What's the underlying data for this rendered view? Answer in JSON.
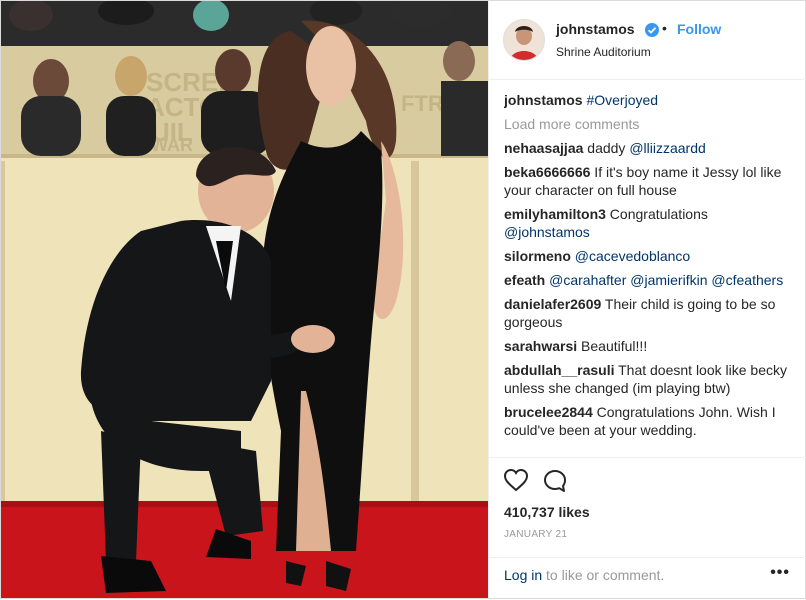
{
  "post": {
    "username": "johnstamos",
    "dot": "•",
    "follow_label": "Follow",
    "location": "Shrine Auditorium",
    "caption_user": "johnstamos",
    "caption_tag": "#Overjoyed",
    "load_more": "Load more comments",
    "likes": "410,737 likes",
    "date": "JANUARY 21",
    "login_link": "Log in",
    "login_rest": " to like or comment.",
    "more": "•••"
  },
  "comments": [
    {
      "user": "nehaasajjaa",
      "parts": [
        {
          "t": " daddy "
        },
        {
          "a": "@lliizzaardd"
        }
      ]
    },
    {
      "user": "beka6666666",
      "parts": [
        {
          "t": " If it's boy name it Jessy lol like your character on full house"
        }
      ]
    },
    {
      "user": "emilyhamilton3",
      "parts": [
        {
          "t": " Congratulations "
        },
        {
          "a": "@johnstamos"
        }
      ]
    },
    {
      "user": "silormeno",
      "parts": [
        {
          "t": " "
        },
        {
          "a": "@cacevedoblanco"
        }
      ]
    },
    {
      "user": "efeath",
      "parts": [
        {
          "t": " "
        },
        {
          "a": "@carahafter"
        },
        {
          "t": " "
        },
        {
          "a": "@jamierifkin"
        },
        {
          "t": " "
        },
        {
          "a": "@cfeathers"
        }
      ]
    },
    {
      "user": "danielafer2609",
      "parts": [
        {
          "t": " Their child is going to be so gorgeous"
        }
      ]
    },
    {
      "user": "sarahwarsi",
      "parts": [
        {
          "t": " Beautiful!!!"
        }
      ]
    },
    {
      "user": "abdullah__rasuli",
      "parts": [
        {
          "t": " That doesnt look like becky unless she changed (im playing btw)"
        }
      ]
    },
    {
      "user": "brucelee2844",
      "parts": [
        {
          "t": " Congratulations John. Wish I could've been at your wedding."
        }
      ]
    }
  ],
  "backdrop_text": [
    "SCREE",
    "ACTO",
    "UIL",
    "WAR",
    "FTRA"
  ],
  "icons": [
    "heart-icon",
    "comment-icon",
    "verified-badge-icon",
    "more-options-icon"
  ],
  "colors": {
    "accent": "#3897f0",
    "link": "#003569",
    "muted": "#999999",
    "carpet": "#c8141a"
  }
}
